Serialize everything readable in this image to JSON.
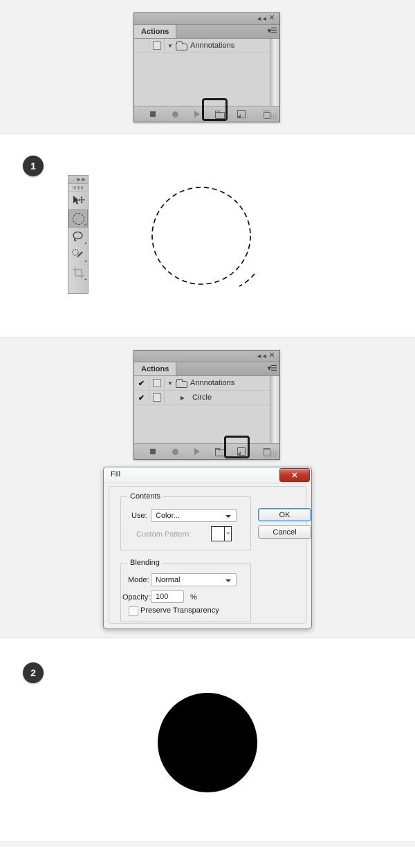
{
  "sections": [
    {
      "id": "step-0-panel",
      "kind": "grey"
    },
    {
      "id": "step-1-canvas",
      "kind": "white",
      "badge": "1"
    },
    {
      "id": "step-2-panel-dialog",
      "kind": "grey"
    },
    {
      "id": "step-3-canvas",
      "kind": "white",
      "badge": "2"
    }
  ],
  "actions_panel_1": {
    "title": "Actions",
    "collapse_icon": "collapse-double-arrow-icon",
    "close_icon": "close-icon",
    "menu_icon": "panel-menu-icon",
    "rows": [
      {
        "check": "",
        "toggle_box": true,
        "expander": "▼",
        "icon": "folder-icon",
        "label": "Annnotations",
        "indent": false
      }
    ],
    "footer_buttons": [
      {
        "name": "stop-button",
        "icon": "stop-square-icon"
      },
      {
        "name": "record-button",
        "icon": "record-circle-icon"
      },
      {
        "name": "play-button",
        "icon": "play-triangle-icon"
      },
      {
        "name": "new-set-button",
        "icon": "new-folder-icon",
        "highlighted": true
      },
      {
        "name": "new-action-button",
        "icon": "new-page-icon",
        "highlighted": false
      },
      {
        "name": "delete-button",
        "icon": "trash-icon"
      }
    ],
    "resize_grip": "resize-grip-icon"
  },
  "actions_panel_2": {
    "title": "Actions",
    "collapse_icon": "collapse-double-arrow-icon",
    "close_icon": "close-icon",
    "menu_icon": "panel-menu-icon",
    "rows": [
      {
        "check": "✔",
        "toggle_box": true,
        "expander": "▼",
        "icon": "folder-icon",
        "label": "Annnotations",
        "indent": false
      },
      {
        "check": "✔",
        "toggle_box": true,
        "expander": "▶",
        "icon": "",
        "label": "Circle",
        "indent": true
      }
    ],
    "footer_buttons": [
      {
        "name": "stop-button",
        "icon": "stop-square-icon"
      },
      {
        "name": "record-button",
        "icon": "record-circle-icon"
      },
      {
        "name": "play-button",
        "icon": "play-triangle-icon"
      },
      {
        "name": "new-set-button",
        "icon": "new-folder-icon",
        "highlighted": false
      },
      {
        "name": "new-action-button",
        "icon": "new-page-icon",
        "highlighted": true
      },
      {
        "name": "delete-button",
        "icon": "trash-icon"
      }
    ],
    "resize_grip": "resize-grip-icon"
  },
  "toolstrip": {
    "collapse_icon": "expand-double-arrow-icon",
    "tools": [
      {
        "name": "move-tool",
        "icon": "move-arrow-icon",
        "selected": false
      },
      {
        "name": "elliptical-marquee-tool",
        "icon": "ellipse-marquee-icon",
        "selected": true
      },
      {
        "name": "lasso-tool",
        "icon": "lasso-icon",
        "selected": false
      },
      {
        "name": "quick-selection-tool",
        "icon": "magic-wand-icon",
        "selected": false
      },
      {
        "name": "crop-tool",
        "icon": "crop-icon",
        "selected": false
      }
    ]
  },
  "fill_dialog": {
    "title": "Fill",
    "close_label": "✕",
    "contents_group": "Contents",
    "use_label": "Use:",
    "use_value": "Color...",
    "custom_pattern_label": "Custom Pattern:",
    "blending_group": "Blending",
    "mode_label": "Mode:",
    "mode_value": "Normal",
    "opacity_label": "Opacity:",
    "opacity_value": "100",
    "percent_label": "%",
    "preserve_label": "Preserve Transparency",
    "ok_label": "OK",
    "cancel_label": "Cancel"
  },
  "canvas_1": {
    "artwork": "dashed-circle-selection"
  },
  "canvas_2": {
    "artwork": "filled-black-circle"
  }
}
